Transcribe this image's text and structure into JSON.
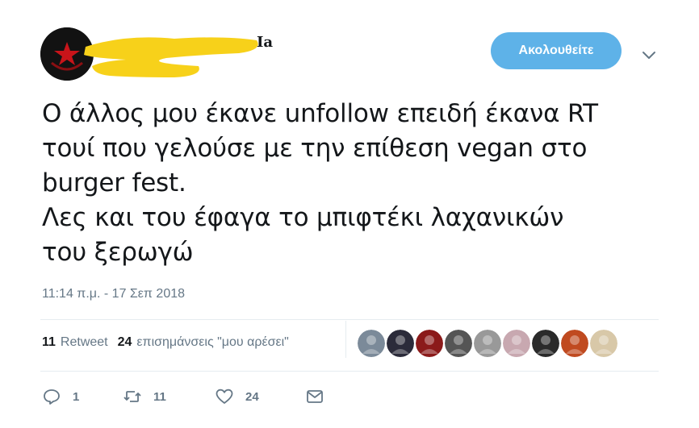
{
  "header": {
    "display_name_visible": "Ia",
    "follow_label": "Ακολουθείτε",
    "colors": {
      "follow_bg": "#5eb2e8",
      "redaction": "#f7d11a"
    }
  },
  "tweet": {
    "lines": [
      "Ο άλλος μου έκανε unfollow επειδή έκανα RT",
      "τουί που γελούσε με την επίθεση vegan στο",
      "burger fest.",
      "Λες και του έφαγα το μπιφτέκι λαχανικών",
      "του ξερωγώ"
    ],
    "timestamp": "11:14 π.μ. - 17 Σεπ 2018"
  },
  "stats": {
    "retweets_count": "11",
    "retweets_label": "Retweet",
    "likes_count": "24",
    "likes_label": "επισημάνσεις \"μου αρέσει\""
  },
  "likers": [
    {
      "icon": "liker-avatar",
      "color": "#7b8a99"
    },
    {
      "icon": "liker-avatar",
      "color": "#2b2b3a"
    },
    {
      "icon": "liker-avatar",
      "color": "#8b1a1a"
    },
    {
      "icon": "liker-avatar",
      "color": "#555555"
    },
    {
      "icon": "liker-avatar",
      "color": "#999999"
    },
    {
      "icon": "liker-avatar",
      "color": "#c8a8b0"
    },
    {
      "icon": "liker-avatar",
      "color": "#2a2a2a"
    },
    {
      "icon": "liker-avatar",
      "color": "#c04a20"
    },
    {
      "icon": "liker-avatar",
      "color": "#d8c8a8"
    }
  ],
  "actions": {
    "reply_count": "1",
    "retweet_count": "11",
    "like_count": "24"
  }
}
